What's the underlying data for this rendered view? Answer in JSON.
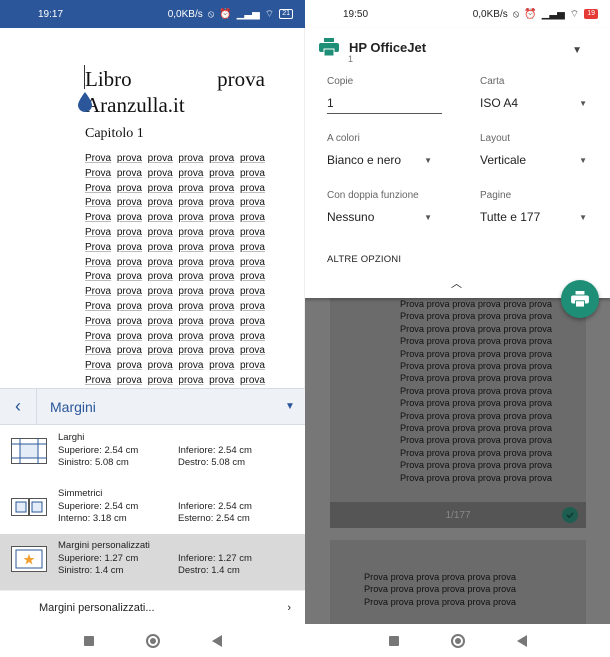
{
  "left": {
    "status": {
      "time": "19:17",
      "speed": "0,0KB/s",
      "battery": "21"
    },
    "doc": {
      "title_word1": "Libro",
      "title_word2": "prova",
      "title_line2": "Aranzulla.it",
      "chapter": "Capitolo 1",
      "lines": [
        [
          "Prova",
          "prova",
          "prova",
          "prova",
          "prova",
          "prova"
        ],
        [
          "Prova",
          "prova",
          "prova",
          "prova",
          "prova",
          "prova"
        ],
        [
          "Prova",
          "prova",
          "prova",
          "prova",
          "prova",
          "prova"
        ],
        [
          "Prova",
          "prova",
          "prova",
          "prova",
          "prova",
          "prova"
        ],
        [
          "Prova",
          "prova",
          "prova",
          "prova",
          "prova",
          "prova"
        ],
        [
          "Prova",
          "prova",
          "prova",
          "prova",
          "prova",
          "prova"
        ],
        [
          "Prova",
          "prova",
          "prova",
          "prova",
          "prova",
          "prova"
        ],
        [
          "Prova",
          "prova",
          "prova",
          "prova",
          "prova",
          "prova"
        ],
        [
          "Prova",
          "prova",
          "prova",
          "prova",
          "prova",
          "prova"
        ],
        [
          "Prova",
          "prova",
          "prova",
          "prova",
          "prova",
          "prova"
        ],
        [
          "Prova",
          "prova",
          "prova",
          "prova",
          "prova",
          "prova"
        ],
        [
          "Prova",
          "prova",
          "prova",
          "prova",
          "prova",
          "prova"
        ],
        [
          "Prova",
          "prova",
          "prova",
          "prova",
          "prova",
          "prova"
        ],
        [
          "Prova",
          "prova",
          "prova",
          "prova",
          "prova",
          "prova"
        ],
        [
          "Prova",
          "prova",
          "prova",
          "prova",
          "prova",
          "prova"
        ],
        [
          "Prova",
          "prova",
          "prova",
          "prova",
          "prova",
          "prova"
        ],
        [
          "Prova",
          "prova",
          "prova",
          "prova",
          "prova",
          "prova"
        ],
        [
          "Prova",
          "prova",
          "prova",
          "prova",
          "prova",
          "prova"
        ]
      ]
    },
    "margins_bar": {
      "title": "Margini"
    },
    "margin_options": [
      {
        "name": "Larghi",
        "top": "Superiore: 2.54 cm",
        "bottom": "Inferiore: 2.54 cm",
        "left": "Sinistro: 5.08 cm",
        "right": "Destro: 5.08 cm"
      },
      {
        "name": "Simmetrici",
        "top": "Superiore: 2.54 cm",
        "bottom": "Inferiore: 2.54 cm",
        "left": "Interno: 3.18 cm",
        "right": "Esterno: 2.54 cm"
      },
      {
        "name": "Margini personalizzati",
        "top": "Superiore: 1.27 cm",
        "bottom": "Inferiore: 1.27 cm",
        "left": "Sinistro: 1.4 cm",
        "right": "Destro: 1.4 cm"
      }
    ],
    "custom_link": "Margini personalizzati..."
  },
  "right": {
    "status": {
      "time": "19:50",
      "speed": "0,0KB/s",
      "battery": "19"
    },
    "printer": {
      "name": "HP OfficeJet",
      "sub": "1"
    },
    "fields": {
      "copie_label": "Copie",
      "copie_value": "1",
      "carta_label": "Carta",
      "carta_value": "ISO A4",
      "colori_label": "A colori",
      "colori_value": "Bianco e nero",
      "layout_label": "Layout",
      "layout_value": "Verticale",
      "doppia_label": "Con doppia funzione",
      "doppia_value": "Nessuno",
      "pagine_label": "Pagine",
      "pagine_value": "Tutte e 177"
    },
    "altre": "ALTRE OPZIONI",
    "page_indicator": "1/177",
    "preview_lines": [
      [
        "Prova",
        "prova",
        "prova",
        "prova",
        "prova",
        "prova"
      ],
      [
        "Prova",
        "prova",
        "prova",
        "prova",
        "prova",
        "prova"
      ],
      [
        "Prova",
        "prova",
        "prova",
        "prova",
        "prova",
        "prova"
      ],
      [
        "Prova",
        "prova",
        "prova",
        "prova",
        "prova",
        "prova"
      ],
      [
        "Prova",
        "prova",
        "prova",
        "prova",
        "prova",
        "prova"
      ],
      [
        "Prova",
        "prova",
        "prova",
        "prova",
        "prova",
        "prova"
      ],
      [
        "Prova",
        "prova",
        "prova",
        "prova",
        "prova",
        "prova"
      ],
      [
        "Prova",
        "prova",
        "prova",
        "prova",
        "prova",
        "prova"
      ],
      [
        "Prova",
        "prova",
        "prova",
        "prova",
        "prova",
        "prova"
      ],
      [
        "Prova",
        "prova",
        "prova",
        "prova",
        "prova",
        "prova"
      ],
      [
        "Prova",
        "prova",
        "prova",
        "prova",
        "prova",
        "prova"
      ],
      [
        "Prova",
        "prova",
        "prova",
        "prova",
        "prova",
        "prova"
      ],
      [
        "Prova",
        "prova",
        "prova",
        "prova",
        "prova",
        "prova"
      ],
      [
        "Prova",
        "prova",
        "prova",
        "prova",
        "prova",
        "prova"
      ],
      [
        "Prova",
        "prova",
        "prova",
        "prova",
        "prova",
        "prova"
      ]
    ],
    "preview2_lines": [
      [
        "Prova",
        "prova",
        "prova",
        "prova",
        "prova",
        "prova"
      ],
      [
        "Prova",
        "prova",
        "prova",
        "prova",
        "prova",
        "prova"
      ],
      [
        "Prova",
        "prova",
        "prova",
        "prova",
        "prova",
        "prova"
      ]
    ]
  },
  "colors": {
    "word_blue": "#2b579a",
    "fab_green": "#1e8e76"
  },
  "icons": [
    "back-chevron-icon",
    "dropdown-icon",
    "printer-icon",
    "check-icon",
    "chevron-right-icon",
    "up-chevron-icon"
  ]
}
